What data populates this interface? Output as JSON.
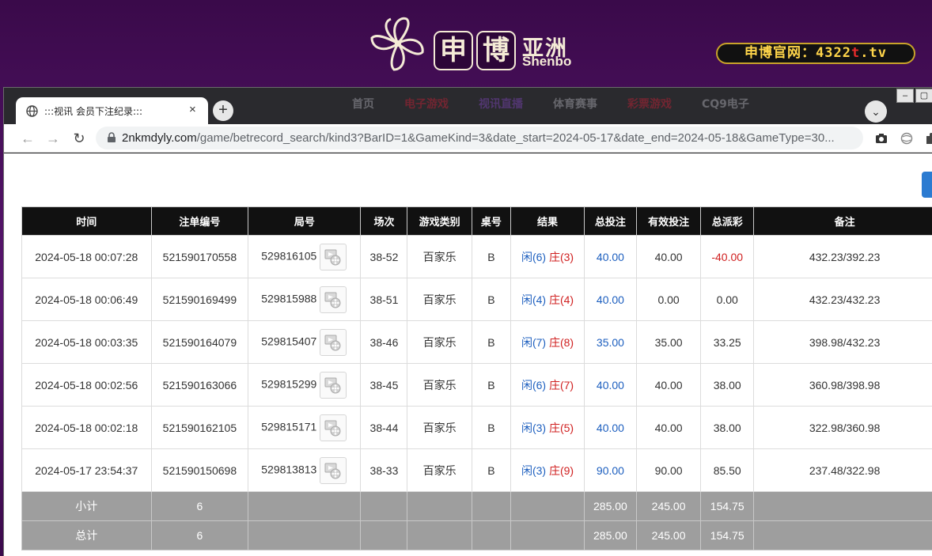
{
  "site": {
    "logo_char1": "申",
    "logo_char2": "博",
    "logo_sub": "亚洲",
    "logo_en": "Shenbo",
    "official_prefix": "申博官网：4322",
    "official_red": "t",
    "official_suffix": ".tv",
    "nav": [
      "首页",
      "电子游戏",
      "视讯直播",
      "体育赛事",
      "彩票游戏",
      "CQ9电子"
    ]
  },
  "browser": {
    "tab_title": ":::视讯 会员下注纪录:::",
    "tab_close": "×",
    "new_tab": "+",
    "url_host": "2nkmdyly.com",
    "url_path": "/game/betrecord_search/kind3?BarID=1&GameKind=3&date_start=2024-05-17&date_end=2024-05-18&GameType=30..."
  },
  "table": {
    "headers": [
      "时间",
      "注单编号",
      "局号",
      "场次",
      "游戏类别",
      "桌号",
      "结果",
      "总投注",
      "有效投注",
      "总派彩",
      "备注"
    ],
    "rows": [
      {
        "time": "2024-05-18 00:07:28",
        "order": "521590170558",
        "round": "529816105",
        "session": "38-52",
        "game": "百家乐",
        "table": "B",
        "res_b": "闲(6)",
        "res_r": "庄(3)",
        "bet": "40.00",
        "valid": "40.00",
        "payout": "-40.00",
        "note": "432.23/392.23"
      },
      {
        "time": "2024-05-18 00:06:49",
        "order": "521590169499",
        "round": "529815988",
        "session": "38-51",
        "game": "百家乐",
        "table": "B",
        "res_b": "闲(4)",
        "res_r": "庄(4)",
        "bet": "40.00",
        "valid": "0.00",
        "payout": "0.00",
        "note": "432.23/432.23"
      },
      {
        "time": "2024-05-18 00:03:35",
        "order": "521590164079",
        "round": "529815407",
        "session": "38-46",
        "game": "百家乐",
        "table": "B",
        "res_b": "闲(7)",
        "res_r": "庄(8)",
        "bet": "35.00",
        "valid": "35.00",
        "payout": "33.25",
        "note": "398.98/432.23"
      },
      {
        "time": "2024-05-18 00:02:56",
        "order": "521590163066",
        "round": "529815299",
        "session": "38-45",
        "game": "百家乐",
        "table": "B",
        "res_b": "闲(6)",
        "res_r": "庄(7)",
        "bet": "40.00",
        "valid": "40.00",
        "payout": "38.00",
        "note": "360.98/398.98"
      },
      {
        "time": "2024-05-18 00:02:18",
        "order": "521590162105",
        "round": "529815171",
        "session": "38-44",
        "game": "百家乐",
        "table": "B",
        "res_b": "闲(3)",
        "res_r": "庄(5)",
        "bet": "40.00",
        "valid": "40.00",
        "payout": "38.00",
        "note": "322.98/360.98"
      },
      {
        "time": "2024-05-17 23:54:37",
        "order": "521590150698",
        "round": "529813813",
        "session": "38-33",
        "game": "百家乐",
        "table": "B",
        "res_b": "闲(3)",
        "res_r": "庄(9)",
        "bet": "90.00",
        "valid": "90.00",
        "payout": "85.50",
        "note": "237.48/322.98"
      }
    ],
    "subtotal": {
      "label": "小计",
      "count": "6",
      "bet": "285.00",
      "valid": "245.00",
      "payout": "154.75"
    },
    "total": {
      "label": "总计",
      "count": "6",
      "bet": "285.00",
      "valid": "245.00",
      "payout": "154.75"
    }
  }
}
